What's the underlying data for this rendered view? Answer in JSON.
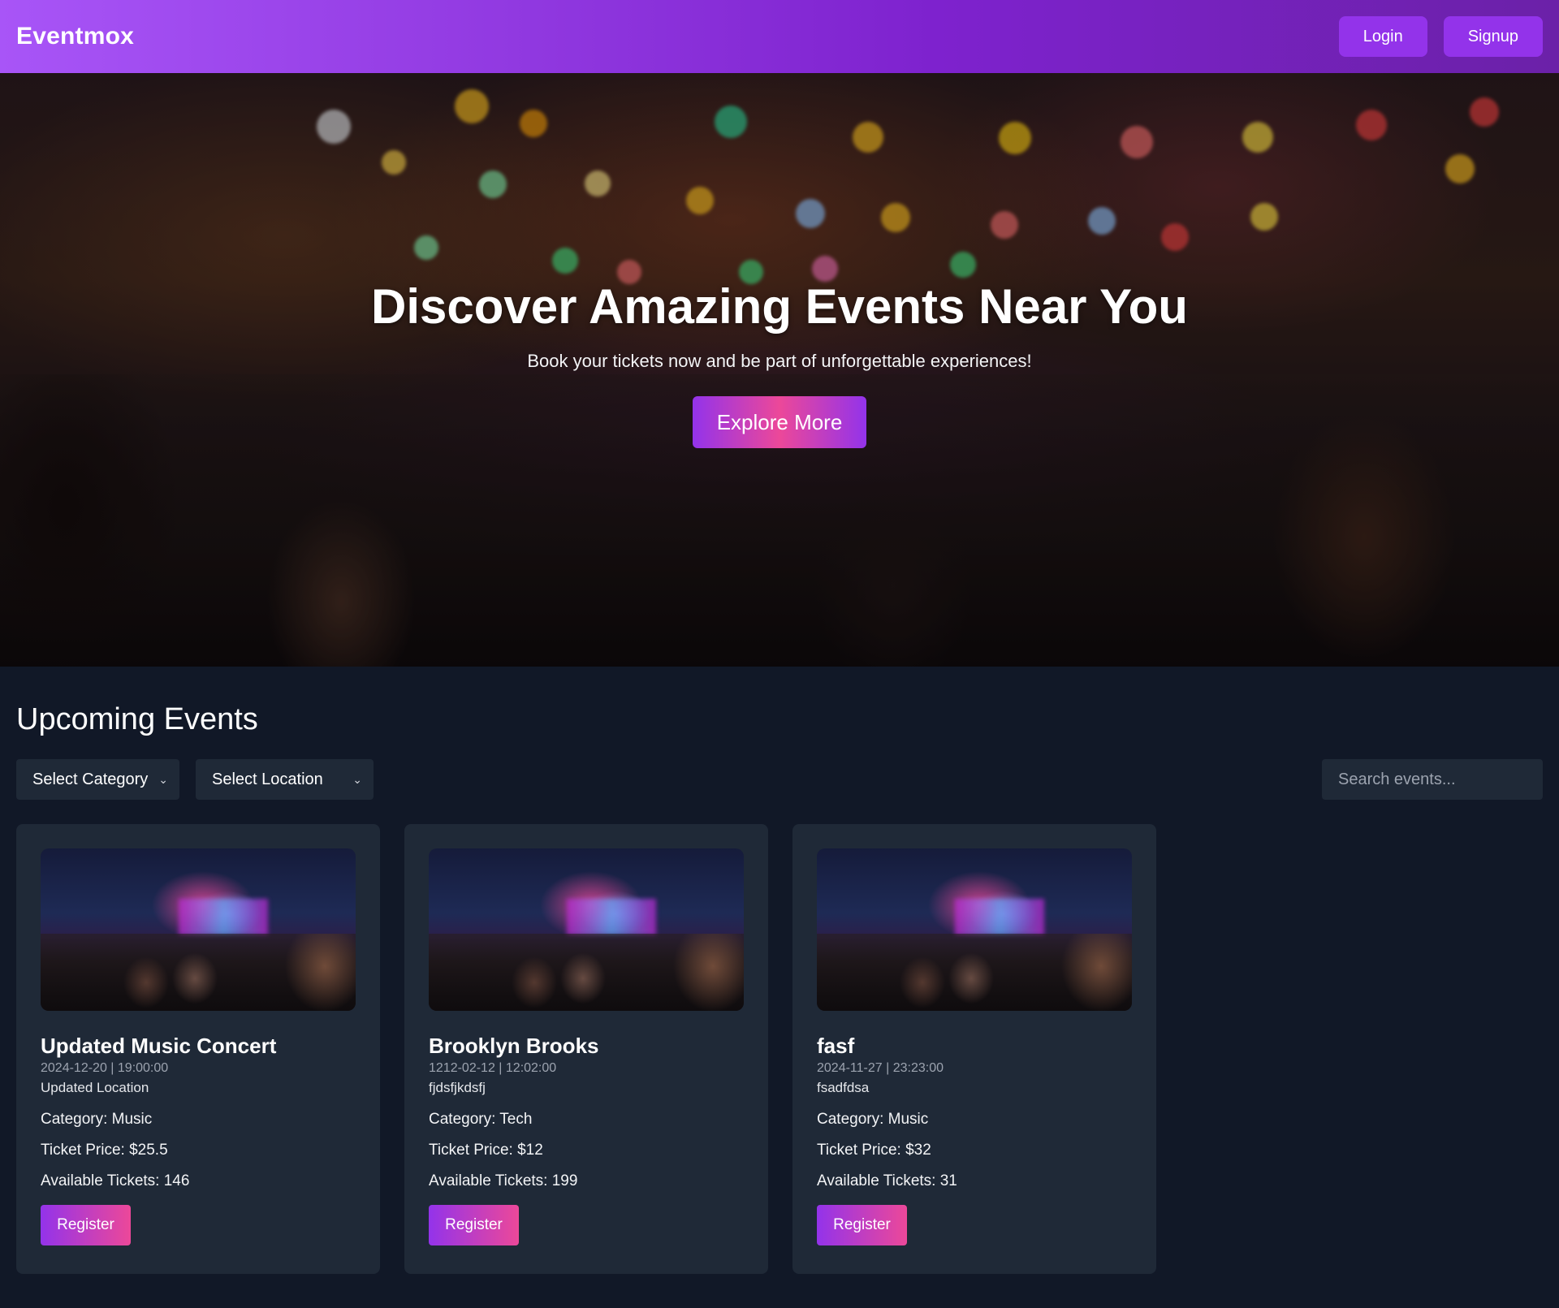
{
  "navbar": {
    "brand": "Eventmox",
    "login_label": "Login",
    "signup_label": "Signup"
  },
  "hero": {
    "title": "Discover Amazing Events Near You",
    "subtitle": "Book your tickets now and be part of unforgettable experiences!",
    "cta_label": "Explore More"
  },
  "events_section": {
    "title": "Upcoming Events",
    "filters": {
      "category_selected": "Select Category",
      "location_selected": "Select Location",
      "search_placeholder": "Search events..."
    },
    "events": [
      {
        "title": "Updated Music Concert",
        "datetime": "2024-12-20 | 19:00:00",
        "location": "Updated Location",
        "category": "Category: Music",
        "price": "Ticket Price: $25.5",
        "available": "Available Tickets: 146",
        "register_label": "Register"
      },
      {
        "title": "Brooklyn Brooks",
        "datetime": "1212-02-12 | 12:02:00",
        "location": "fjdsfjkdsfj",
        "category": "Category: Tech",
        "price": "Ticket Price: $12",
        "available": "Available Tickets: 199",
        "register_label": "Register"
      },
      {
        "title": "fasf",
        "datetime": "2024-11-27 | 23:23:00",
        "location": "fsadfdsa",
        "category": "Category: Music",
        "price": "Ticket Price: $32",
        "available": "Available Tickets: 31",
        "register_label": "Register"
      }
    ]
  },
  "colors": {
    "page_bg": "#111827",
    "card_bg": "#1f2937",
    "accent_purple": "#9333ea",
    "accent_pink": "#ec4899"
  }
}
